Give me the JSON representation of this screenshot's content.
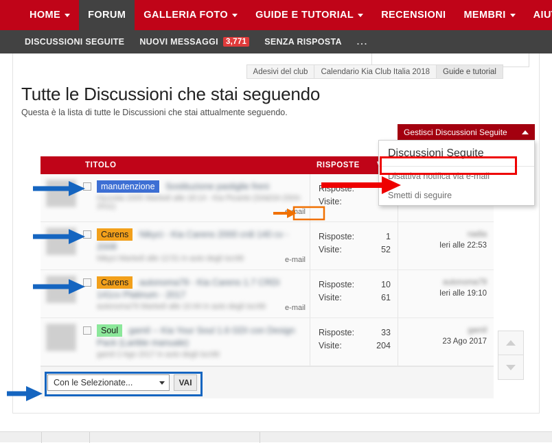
{
  "navbar": {
    "items": [
      {
        "label": "HOME",
        "has_caret": true,
        "active": false
      },
      {
        "label": "FORUM",
        "has_caret": false,
        "active": true
      },
      {
        "label": "GALLERIA FOTO",
        "has_caret": true,
        "active": false
      },
      {
        "label": "GUIDE E TUTORIAL",
        "has_caret": true,
        "active": false
      },
      {
        "label": "RECENSIONI",
        "has_caret": false,
        "active": false
      },
      {
        "label": "MEMBRI",
        "has_caret": true,
        "active": false
      },
      {
        "label": "AIUTO",
        "has_caret": false,
        "active": false
      }
    ],
    "bg_color": "#c00418",
    "active_bg_color": "#424242"
  },
  "subnav": {
    "items": [
      {
        "label": "DISCUSSIONI SEGUITE",
        "badge": ""
      },
      {
        "label": "NUOVI MESSAGGI",
        "badge": "3,771"
      },
      {
        "label": "SENZA RISPOSTA",
        "badge": ""
      },
      {
        "label": "...",
        "badge": ""
      }
    ],
    "bg_color": "#424242",
    "badge_color": "#e03b3b"
  },
  "tabstrip": {
    "tabs": [
      {
        "label": "Adesivi del club",
        "current": false
      },
      {
        "label": "Calendario Kia Club Italia 2018",
        "current": false
      },
      {
        "label": "Guide e tutorial",
        "current": true
      }
    ]
  },
  "header": {
    "title": "Tutte le Discussioni che stai seguendo",
    "subtitle": "Questa è la lista di tutte le Discussioni che stai attualmente seguendo."
  },
  "manage_dropdown": {
    "button_label": "Gestisci Discussioni Seguite",
    "caret_icon": "chevron-up-icon",
    "menu_title": "Discussioni Seguite",
    "options": [
      {
        "label": "Disattiva notifica via e-mail",
        "highlighted": true
      },
      {
        "label": "Smetti di seguire",
        "highlighted": false
      }
    ]
  },
  "table": {
    "columns": {
      "title": "TITOLO",
      "replies": "RISPOSTE",
      "views": "VI"
    },
    "stat_labels": {
      "replies": "Risposte:",
      "views": "Visite:"
    },
    "email_tag": "e-mail",
    "rows": [
      {
        "prefix": "manutenzione",
        "prefix_bg": "#3d6fd4",
        "prefix_fg": "#ffffff",
        "title": "Sostituzione pastiglie freni",
        "meta": "Hyundai 2005 Martedì alle 18:14 - Kia Picanto (SA&SA 2004-2011)",
        "replies": "",
        "views": "",
        "last_user": "",
        "last_date": ""
      },
      {
        "prefix": "Carens",
        "prefix_bg": "#f2a01b",
        "prefix_fg": "#1b1b1b",
        "title": "Nikyci - Kia Carens 2000 crdi 140 cv - 2008",
        "meta": "Nikyci Martedì alle 12:51 in auto degli iscritti",
        "replies": "1",
        "views": "52",
        "last_user": "nadia",
        "last_date": "Ieri alle 22:53"
      },
      {
        "prefix": "Carens",
        "prefix_bg": "#f2a01b",
        "prefix_fg": "#1b1b1b",
        "title": "autonoma79 - Kia Carens 1.7 CRDi 141cv Platinum - 2017",
        "meta": "autonoma79 Martedì alle 10:44 in auto degli iscritti",
        "replies": "10",
        "views": "61",
        "last_user": "autonoma79",
        "last_date": "Ieri alle 19:10"
      },
      {
        "prefix": "Soul",
        "prefix_bg": "#8ce89b",
        "prefix_fg": "#1b1b1b",
        "title": "gamil -- Kia Your Soul 1.6 GDI con Design Pack (Lartitie manuale)",
        "meta": "gamil 2 Ago 2017 in auto degli iscritti",
        "replies": "33",
        "views": "204",
        "last_user": "gamil",
        "last_date": "23 Ago 2017"
      }
    ]
  },
  "footer": {
    "select_value": "Con le Selezionate...",
    "select_caret_icon": "chevron-down-icon",
    "go_label": "VAI"
  },
  "scroll": {
    "up_icon": "chevron-up-icon",
    "down_icon": "chevron-down-icon"
  },
  "annotations": {
    "blue_color": "#1565c0",
    "red_color": "#ee0000",
    "orange_color": "#f07000"
  }
}
